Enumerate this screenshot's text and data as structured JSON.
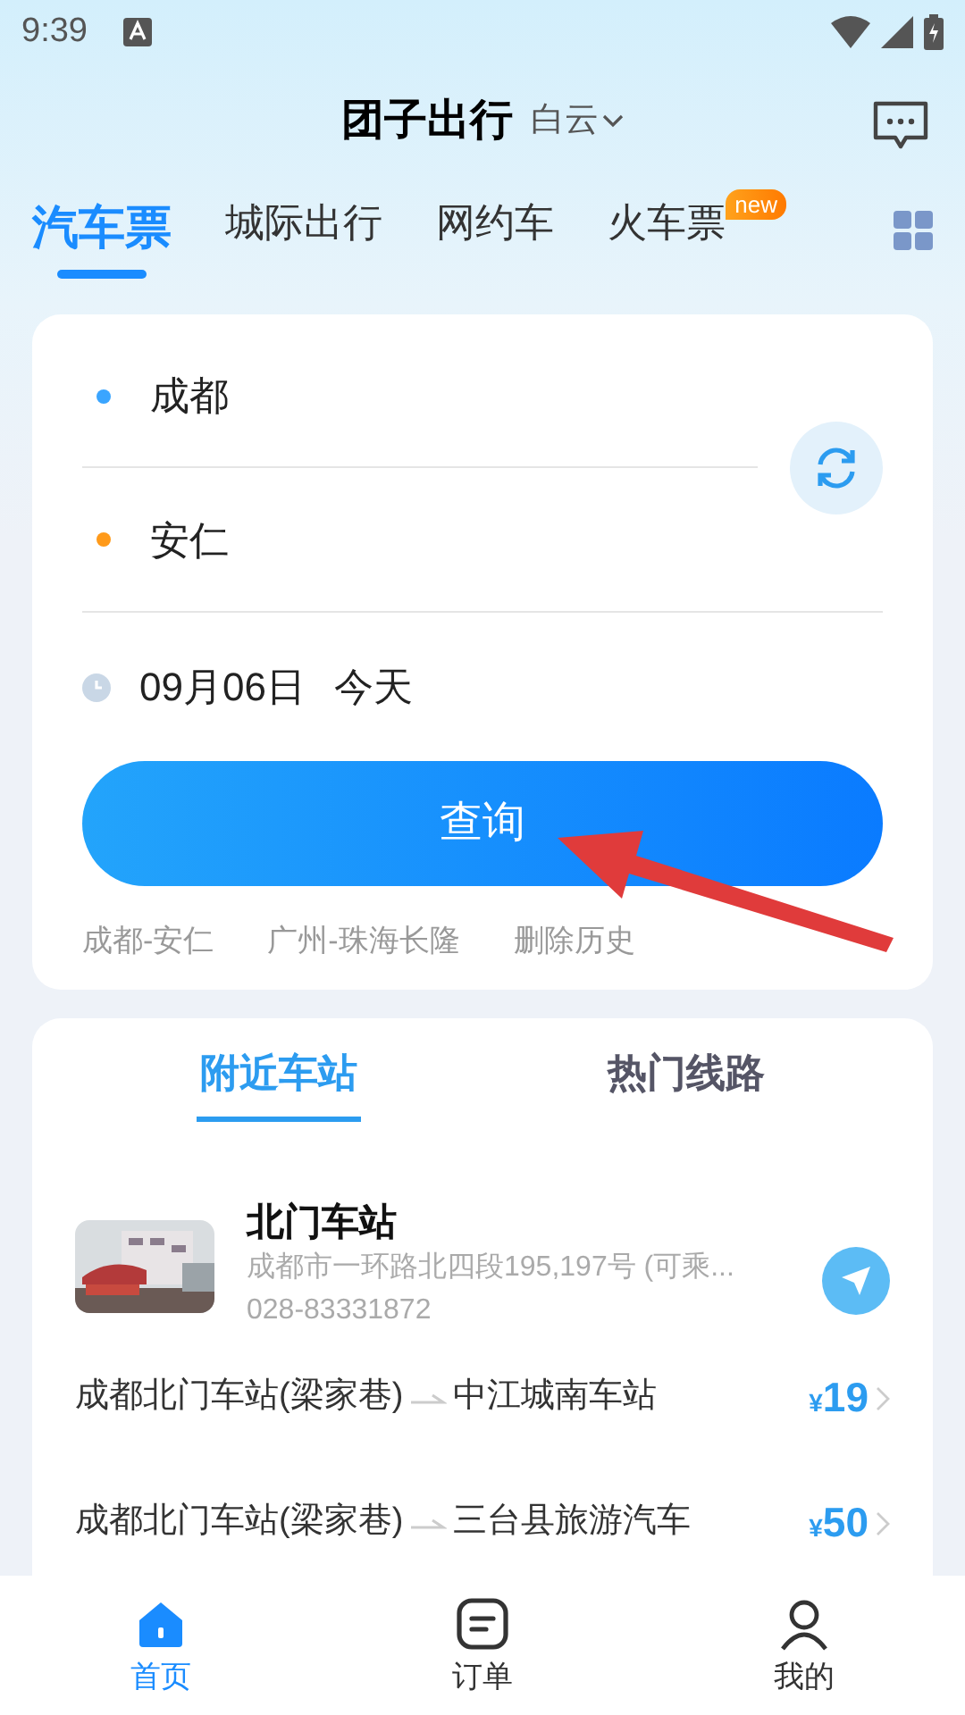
{
  "status_bar": {
    "time": "9:39"
  },
  "header": {
    "title": "团子出行",
    "city": "白云"
  },
  "tabs": [
    {
      "label": "汽车票",
      "selected": true
    },
    {
      "label": "城际出行",
      "selected": false
    },
    {
      "label": "网约车",
      "selected": false
    },
    {
      "label": "火车票",
      "selected": false,
      "badge": "new"
    }
  ],
  "search": {
    "from": "成都",
    "to": "安仁",
    "date": "09月06日",
    "day": "今天",
    "button": "查询",
    "history": [
      "成都-安仁",
      "广州-珠海长隆",
      "删除历史"
    ]
  },
  "nearby": {
    "tabs": [
      {
        "label": "附近车站",
        "selected": true
      },
      {
        "label": "热门线路",
        "selected": false
      }
    ],
    "station": {
      "name": "北门车站",
      "address": "成都市一环路北四段195,197号 (可乘...",
      "phone": "028-83331872"
    },
    "routes": [
      {
        "from": "成都北门车站(梁家巷)",
        "to": "中江城南车站",
        "currency": "¥",
        "price": "19"
      },
      {
        "from": "成都北门车站(梁家巷)",
        "to": "三台县旅游汽车",
        "currency": "¥",
        "price": "50"
      }
    ]
  },
  "bottom_nav": [
    {
      "label": "首页",
      "selected": true
    },
    {
      "label": "订单",
      "selected": false
    },
    {
      "label": "我的",
      "selected": false
    }
  ]
}
